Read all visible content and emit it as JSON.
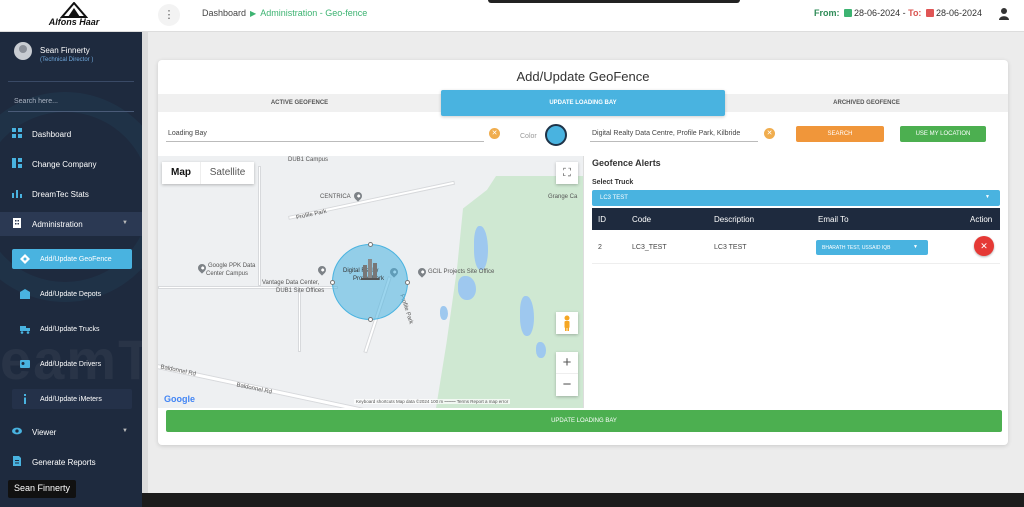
{
  "header": {
    "logo_text": "Alfons Haar",
    "menu_icon": "more-vertical-icon",
    "breadcrumb": [
      "Dashboard",
      "Administration",
      "Geo-fence"
    ],
    "date_from_label": "From:",
    "date_from": "28-06-2024",
    "date_to_label": "To:",
    "date_to": "28-06-2024"
  },
  "sidebar": {
    "user_name": "Sean Finnerty",
    "user_role": "(Technical Director )",
    "search_placeholder": "Search here...",
    "items": [
      {
        "label": "Dashboard",
        "icon": "dashboard-icon"
      },
      {
        "label": "Change Company",
        "icon": "grid-icon"
      },
      {
        "label": "DreamTec Stats",
        "icon": "bar-chart-icon"
      },
      {
        "label": "Administration",
        "icon": "building-icon"
      }
    ],
    "admin_subitems": [
      {
        "label": "Add/Update GeoFence",
        "icon": "geofence-icon"
      },
      {
        "label": "Add/Update Depots",
        "icon": "depot-icon"
      },
      {
        "label": "Add/Update Trucks",
        "icon": "truck-icon"
      },
      {
        "label": "Add/Update Drivers",
        "icon": "driver-icon"
      },
      {
        "label": "Add/Update iMeters",
        "icon": "info-icon"
      }
    ],
    "viewer_label": "Viewer",
    "reports_label": "Generate Reports",
    "tooltip": "Sean Finnerty",
    "watermark": "eamT"
  },
  "card": {
    "title": "Add/Update GeoFence",
    "tabs": [
      "ACTIVE GEOFENCE",
      "UPDATE LOADING BAY",
      "ARCHIVED GEOFENCE"
    ],
    "name_value": "Loading Bay",
    "color_label": "Color",
    "color": "#49b3e0",
    "address_value": "Digital Realty Data Centre, Profile Park, Kilbride",
    "search_btn": "SEARCH",
    "use_location_btn": "USE MY LOCATION",
    "update_btn": "UPDATE LOADING BAY"
  },
  "map": {
    "toggle_map": "Map",
    "toggle_satellite": "Satellite",
    "labels": {
      "dub1": "DUB1 Campus",
      "centrica": "CENTRICA",
      "grange": "Grange Ca",
      "profile_park_road": "Profile Park",
      "google_ppk_1": "Google PPK Data",
      "google_ppk_2": "Center Campus",
      "vantage_1": "Vantage Data Center,",
      "vantage_2": "DUB1 Site Offices",
      "digital_1": "Digital Realty",
      "digital_2": "Profile Park",
      "gcil": "GCIL Projects Site Office",
      "baldonnel_1": "Baldonnel Rd",
      "baldonnel_2": "Baldonnel Rd",
      "profile_park_road2": "Profile Park"
    },
    "google": "Google",
    "attribution": "Keyboard shortcuts    Map data ©2024    100 m ⎯⎯⎯⎯⎯    Terms    Report a map error"
  },
  "alerts": {
    "title": "Geofence Alerts",
    "select_label": "Select Truck",
    "selected_truck": "LC3 TEST",
    "columns": [
      "ID",
      "Code",
      "Description",
      "Email To",
      "Action"
    ],
    "rows": [
      {
        "id": "2",
        "code": "LC3_TEST",
        "description": "LC3 TEST",
        "email": "BHARATH TEST, USSAID IQB"
      }
    ]
  }
}
